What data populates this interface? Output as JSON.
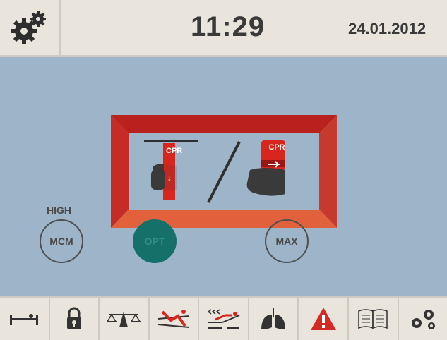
{
  "header": {
    "time": "11:29",
    "date": "24.01.2012"
  },
  "cpr": {
    "tag_left": "CPR",
    "tag_right": "CPR",
    "separator": "/"
  },
  "modes": {
    "high_label": "HIGH",
    "mcm_label": "MCM",
    "opt_label": "OPT",
    "max_label": "MAX"
  },
  "toolbar": {
    "icons": [
      "bed-icon",
      "lock-icon",
      "scale-icon",
      "patient-turn-icon",
      "bed-position-icon",
      "lungs-icon",
      "warning-icon",
      "manual-icon",
      "settings-icon"
    ]
  },
  "colors": {
    "frame_red": "#c72b26",
    "frame_orange": "#e2613d",
    "opt_teal": "#16706a",
    "warning_red": "#d42a26",
    "background": "#9eb4c9"
  }
}
